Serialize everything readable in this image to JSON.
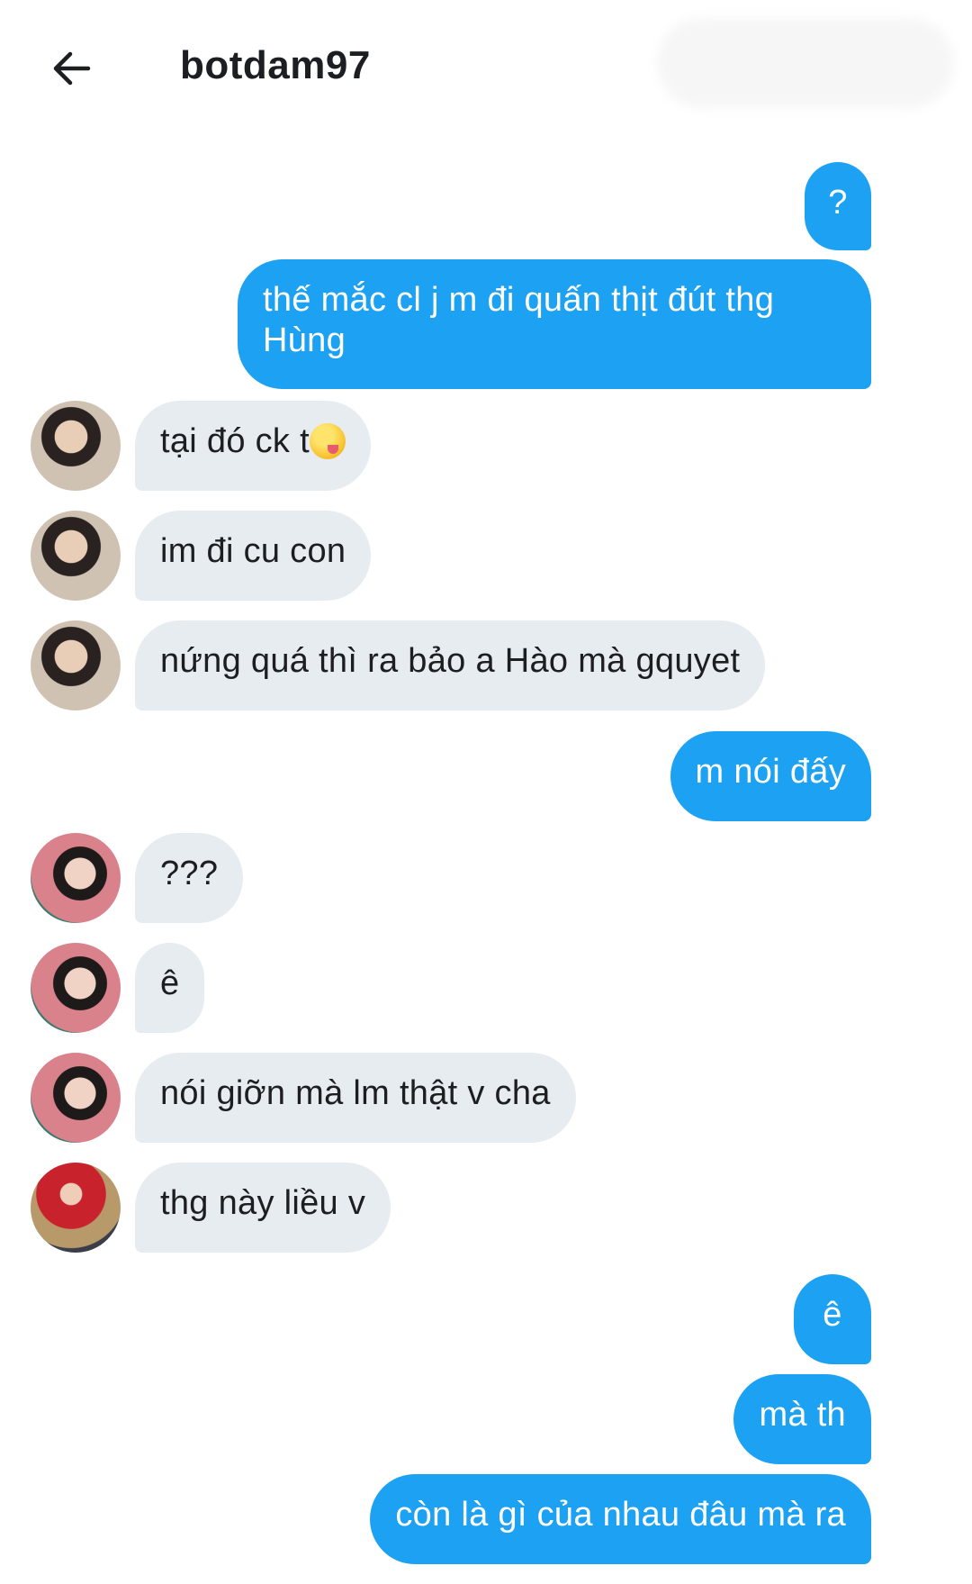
{
  "header": {
    "title": "botdam97",
    "back_icon": "arrow-left-icon"
  },
  "colors": {
    "sent_bubble": "#1da1f2",
    "received_bubble": "#e6ecf0",
    "text_dark": "#1c1e21"
  },
  "messages": [
    {
      "side": "sent",
      "text": "?"
    },
    {
      "side": "sent",
      "text": "thế mắc cl j m đi quấn thịt đút thg\nHùng"
    },
    {
      "side": "received",
      "text": "tại đó ck t",
      "emoji": "face-savoring-food-emoji"
    },
    {
      "side": "received",
      "text": "im đi cu con"
    },
    {
      "side": "received",
      "text": "nứng quá thì ra bảo a Hào mà gquyet"
    },
    {
      "side": "sent",
      "text": "m nói đấy"
    },
    {
      "side": "received",
      "text": "???"
    },
    {
      "side": "received",
      "text": "ê"
    },
    {
      "side": "received",
      "text": "nói giỡn mà lm thật v cha"
    },
    {
      "side": "received",
      "text": "thg này liều v"
    },
    {
      "side": "sent",
      "text": "ê"
    },
    {
      "side": "sent",
      "text": "mà th"
    },
    {
      "side": "sent",
      "text": "còn là gì của nhau đâu mà ra"
    }
  ]
}
